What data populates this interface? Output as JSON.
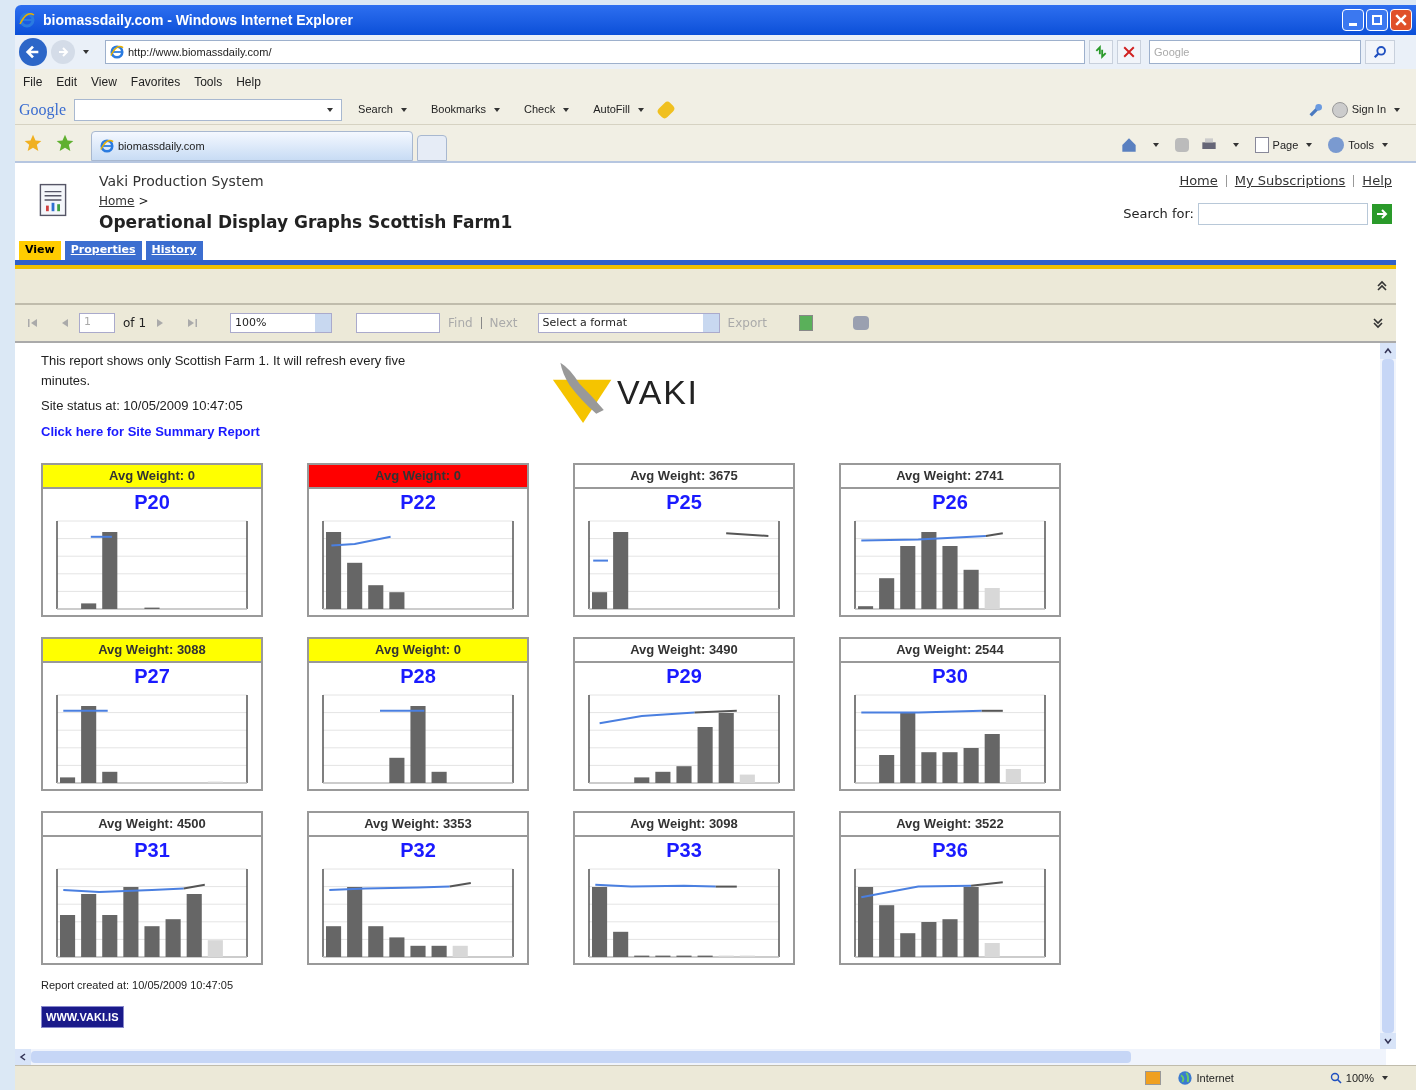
{
  "window": {
    "title": "biomassdaily.com - Windows Internet Explorer"
  },
  "address_bar": {
    "url": "http://www.biomassdaily.com/",
    "search_placeholder": "Google"
  },
  "menu": [
    "File",
    "Edit",
    "View",
    "Favorites",
    "Tools",
    "Help"
  ],
  "google_toolbar": {
    "logo": "Google",
    "items": [
      "Search",
      "Bookmarks",
      "Check",
      "AutoFill"
    ],
    "sign_in": "Sign In"
  },
  "browser_tabs": [
    {
      "label": "biomassdaily.com",
      "selected": true
    }
  ],
  "command_bar": [
    "Page",
    "Tools"
  ],
  "page": {
    "app_name": "Vaki Production System",
    "breadcrumb": "Home",
    "breadcrumb_separator": ">",
    "title": "Operational Display Graphs Scottish Farm1",
    "top_links": [
      "Home",
      "My Subscriptions",
      "Help"
    ],
    "search_label": "Search for:",
    "tabs": [
      {
        "label": "View",
        "selected": true
      },
      {
        "label": "Properties",
        "selected": false
      },
      {
        "label": "History",
        "selected": false
      }
    ],
    "toolbar": {
      "page": "1",
      "of": "of 1",
      "zoom": "100%",
      "find": "Find",
      "next": "Next",
      "format": "Select a format",
      "export": "Export"
    }
  },
  "report": {
    "description": "This report shows only Scottish Farm 1. It will refresh every five minutes.",
    "status": "Site status at: 10/05/2009 10:47:05",
    "link": "Click here for Site Summary Report",
    "logo": "VAKI",
    "cards": [
      {
        "header": "Avg Weight: 0",
        "pen": "P20",
        "color": "#ffff00"
      },
      {
        "header": "Avg Weight: 0",
        "pen": "P22",
        "color": "#ff0000"
      },
      {
        "header": "Avg Weight: 3675",
        "pen": "P25",
        "color": "#ffffff"
      },
      {
        "header": "Avg Weight: 2741",
        "pen": "P26",
        "color": "#ffffff"
      },
      {
        "header": "Avg Weight: 3088",
        "pen": "P27",
        "color": "#ffff00"
      },
      {
        "header": "Avg Weight: 0",
        "pen": "P28",
        "color": "#ffff00"
      },
      {
        "header": "Avg Weight: 3490",
        "pen": "P29",
        "color": "#ffffff"
      },
      {
        "header": "Avg Weight: 2544",
        "pen": "P30",
        "color": "#ffffff"
      },
      {
        "header": "Avg Weight: 4500",
        "pen": "P31",
        "color": "#ffffff"
      },
      {
        "header": "Avg Weight: 3353",
        "pen": "P32",
        "color": "#ffffff"
      },
      {
        "header": "Avg Weight: 3098",
        "pen": "P33",
        "color": "#ffffff"
      },
      {
        "header": "Avg Weight: 3522",
        "pen": "P36",
        "color": "#ffffff"
      }
    ],
    "footer": "Report created at: 10/05/2009 10:47:05",
    "badge": "WWW.VAKI.IS"
  },
  "status_bar": {
    "zone": "Internet",
    "zoom": "100%"
  }
}
